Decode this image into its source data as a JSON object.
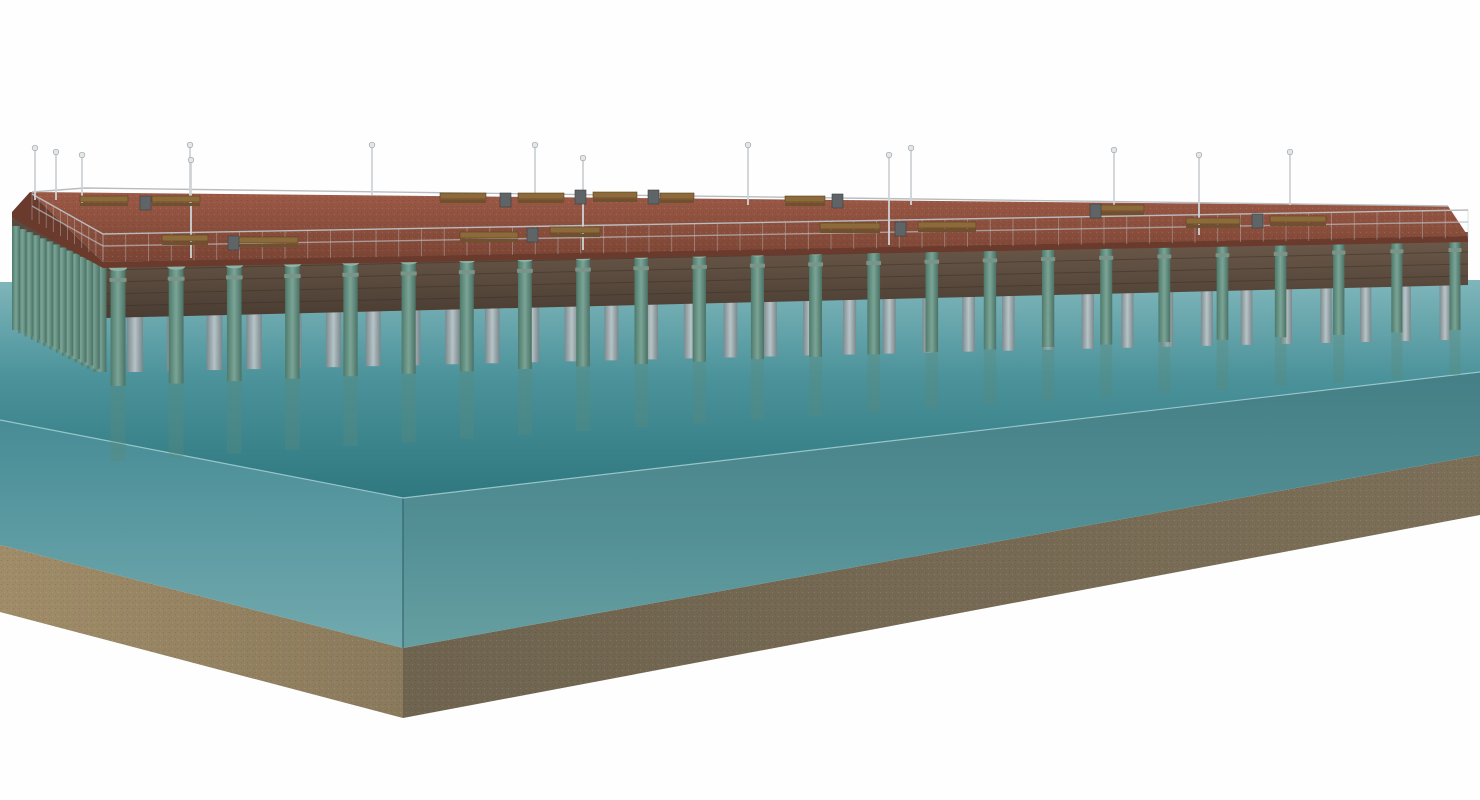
{
  "scene": {
    "subject": "pier-on-water-cross-section",
    "background_color": "#fefefe",
    "colors": {
      "deck": "#8a4c3c",
      "deck_far": "#a65a47",
      "beam": "#5a4a3e",
      "pile_green": "#5d8a7c",
      "pile_gray": "#9aa3a6",
      "water_surface": "#3f8c94",
      "water_front": "#3d7680",
      "water_side": "#5a9ba3",
      "seabed_front": "#7a6d57",
      "seabed_side": "#9a8662",
      "railing": "#b9bcbf",
      "bench": "#8c6a3a",
      "lamp": "#cfd3d6"
    }
  }
}
